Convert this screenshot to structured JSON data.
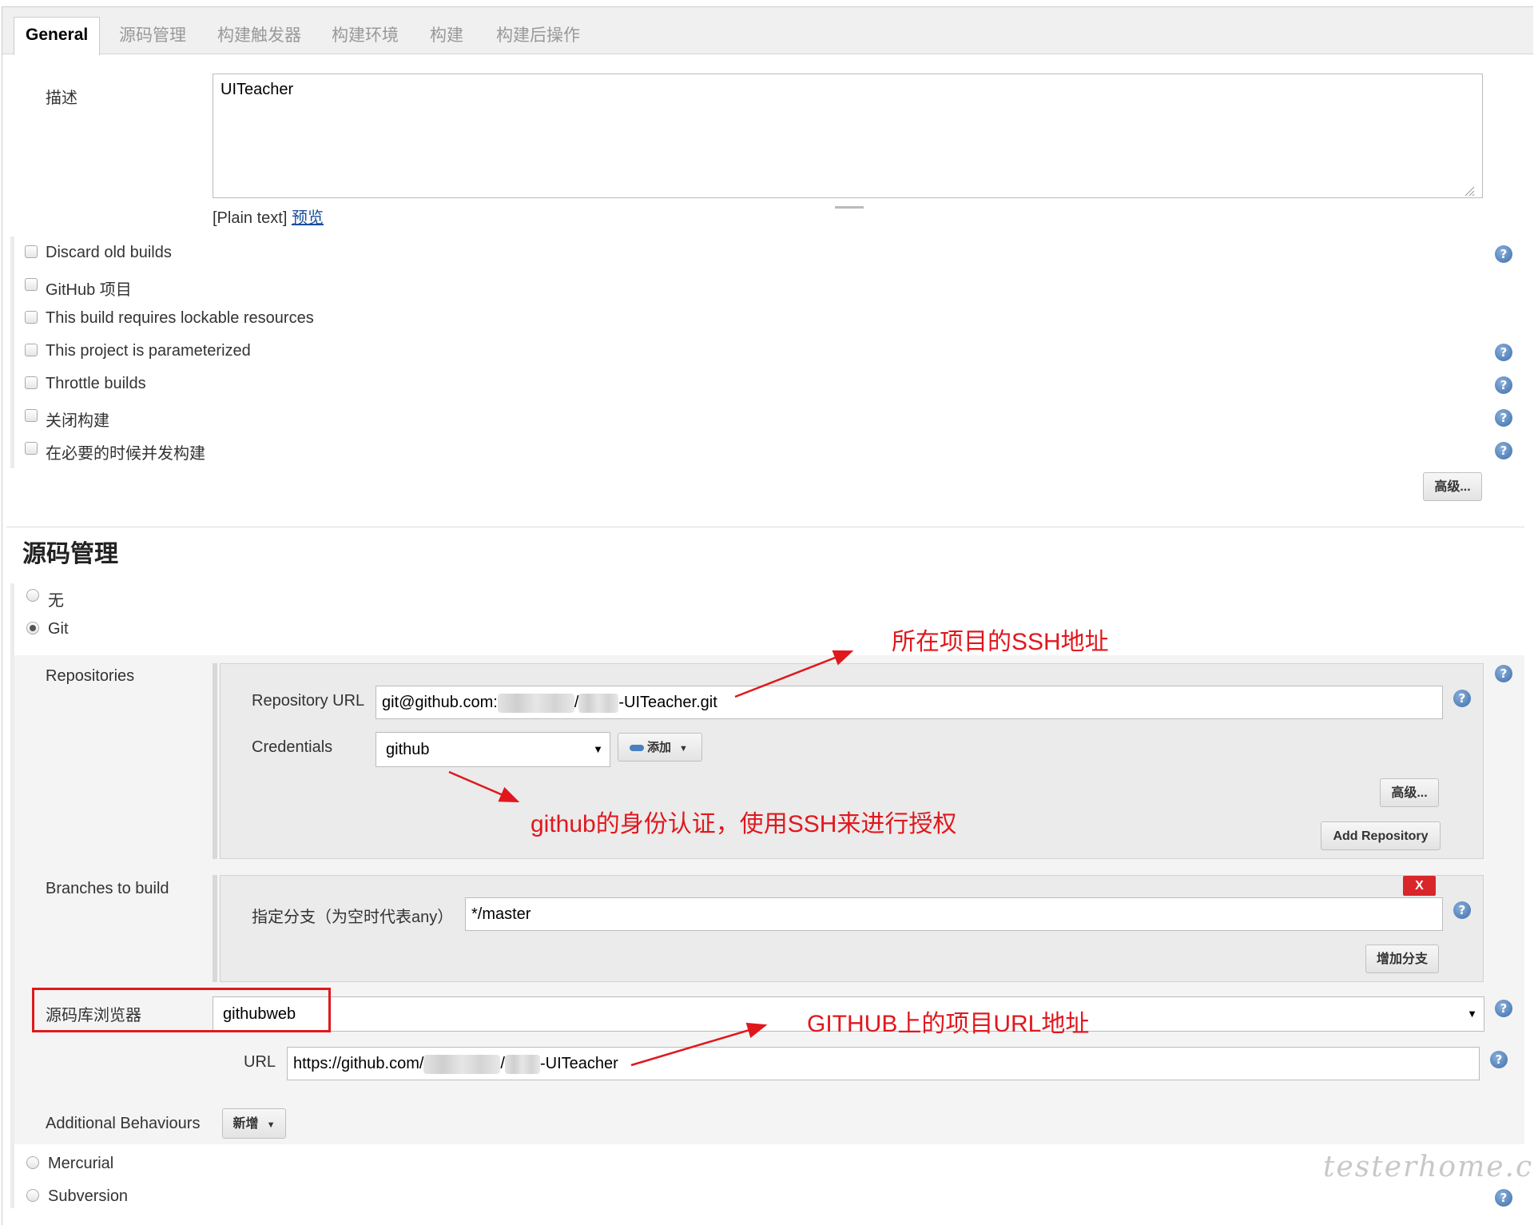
{
  "tabs": [
    "General",
    "源码管理",
    "构建触发器",
    "构建环境",
    "构建",
    "构建后操作"
  ],
  "description": {
    "label": "描述",
    "value": "UITeacher",
    "format": "[Plain text]",
    "preview_link": "预览"
  },
  "options": [
    "Discard old builds",
    "GitHub 项目",
    "This build requires lockable resources",
    "This project is parameterized",
    "Throttle builds",
    "关闭构建",
    "在必要的时候并发构建"
  ],
  "advanced_button": "高级...",
  "scm": {
    "title": "源码管理",
    "options": {
      "none": "无",
      "git": "Git",
      "mercurial": "Mercurial",
      "subversion": "Subversion"
    },
    "repositories_label": "Repositories",
    "repo_url_label": "Repository URL",
    "repo_url_prefix": "git@github.com:",
    "repo_url_mid": "/",
    "repo_url_suffix": "-UITeacher.git",
    "credentials_label": "Credentials",
    "credentials_value": "github",
    "add_credentials": "添加",
    "repo_advanced": "高级...",
    "add_repository": "Add Repository",
    "branches_label": "Branches to build",
    "branch_spec_label": "指定分支（为空时代表any）",
    "branch_spec_value": "*/master",
    "delete_branch": "X",
    "add_branch": "增加分支",
    "browser_label": "源码库浏览器",
    "browser_value": "githubweb",
    "browser_url_label": "URL",
    "browser_url_prefix": "https://github.com/",
    "browser_url_mid": "/",
    "browser_url_suffix": "-UITeacher",
    "additional_behaviours_label": "Additional Behaviours",
    "add_behaviour": "新增"
  },
  "annotations": {
    "ssh_address": "所在项目的SSH地址",
    "credentials_note": "github的身份认证，使用SSH来进行授权",
    "github_url": "GITHUB上的项目URL地址"
  },
  "watermark": "testerhome.com",
  "colors": {
    "annotation": "#e0181e",
    "link": "#1a4e9c",
    "help_icon": "#3d6ea8",
    "delete_button": "#d9262a"
  }
}
